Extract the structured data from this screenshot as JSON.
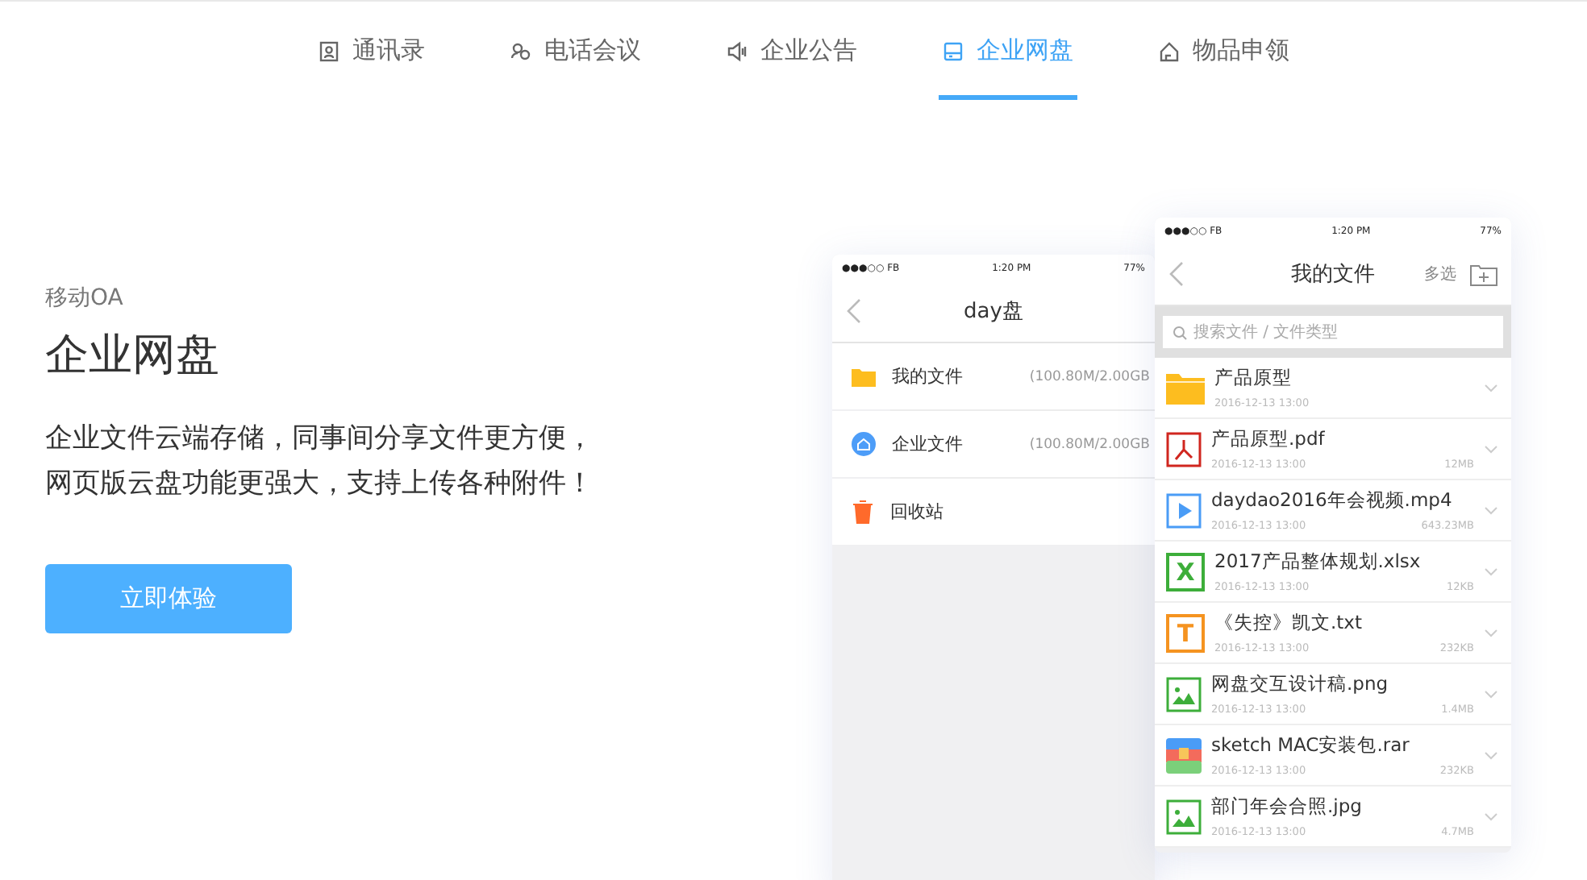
{
  "tabs": [
    {
      "label": "通讯录",
      "selected": false
    },
    {
      "label": "电话会议",
      "selected": false
    },
    {
      "label": "企业公告",
      "selected": false
    },
    {
      "label": "企业网盘",
      "selected": true
    },
    {
      "label": "物品申领",
      "selected": false
    }
  ],
  "hero": {
    "eyebrow": "移动OA",
    "title": "企业网盘",
    "description": [
      "企业文件云端存储，同事间分享文件更方便，",
      "网页版云盘功能更强大，支持上传各种附件！"
    ],
    "button": "立即体验"
  },
  "back_phone": {
    "status": {
      "carrier": "●●●○○ FB",
      "time": "1:20 PM",
      "battery": "77%"
    },
    "title": "day盘",
    "items": [
      {
        "kind": "folder",
        "label": "我的文件",
        "usage": "(100.80M/2.00GB"
      },
      {
        "kind": "company",
        "label": "企业文件",
        "usage": "(100.80M/2.00GB"
      },
      {
        "kind": "trash",
        "label": "回收站"
      }
    ]
  },
  "front_phone": {
    "status": {
      "carrier": "●●●○○ FB",
      "time": "1:20 PM",
      "battery": "77%"
    },
    "title": "我的文件",
    "action": "多选",
    "search": {
      "placeholder": "搜索文件 / 文件类型"
    },
    "files": [
      {
        "kind": "folder",
        "name": "产品原型",
        "date": "2016-12-13 13:00"
      },
      {
        "kind": "pdf",
        "name": "产品原型.pdf",
        "date": "2016-12-13 13:00",
        "size": "12MB"
      },
      {
        "kind": "video",
        "name": "daydao2016年会视频.mp4",
        "date": "2016-12-13 13:00",
        "size": "643.23MB"
      },
      {
        "kind": "sheet",
        "glyph": "X",
        "name": "2017产品整体规划.xlsx",
        "date": "2016-12-13 13:00",
        "size": "12KB"
      },
      {
        "kind": "text",
        "glyph": "T",
        "name": "《失控》凯文.txt",
        "date": "2016-12-13 13:00",
        "size": "232KB"
      },
      {
        "kind": "image",
        "name": "网盘交互设计稿.png",
        "date": "2016-12-13 13:00",
        "size": "1.4MB"
      },
      {
        "kind": "archive",
        "name": "sketch MAC安装包.rar",
        "date": "2016-12-13 13:00",
        "size": "232KB"
      },
      {
        "kind": "image",
        "name": "部门年会合照.jpg",
        "date": "2016-12-13 13:00",
        "size": "4.7MB"
      }
    ]
  }
}
